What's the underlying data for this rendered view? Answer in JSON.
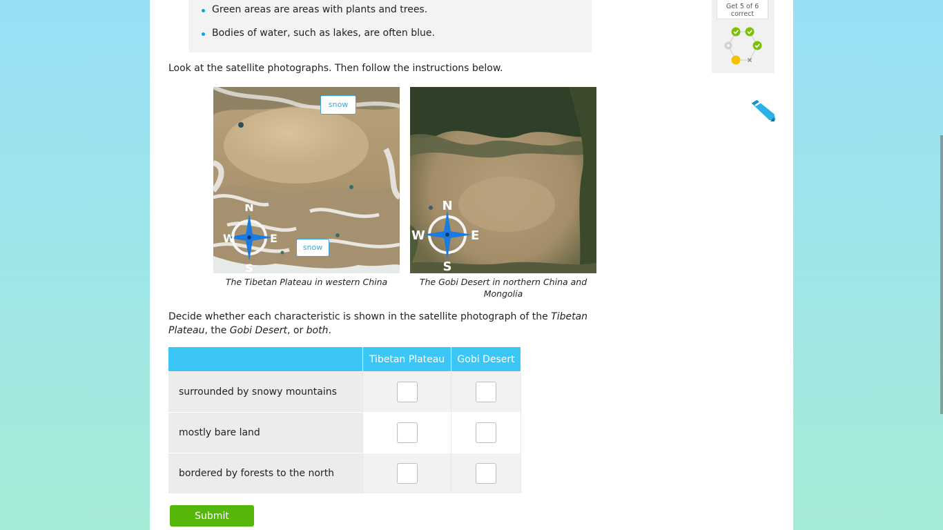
{
  "hints": [
    "Green areas are areas with plants and trees.",
    "Bodies of water, such as lakes, are often blue."
  ],
  "instructions": "Look at the satellite photographs. Then follow the instructions below.",
  "photos": [
    {
      "caption": "The Tibetan Plateau in western China",
      "labels": [
        "snow",
        "snow"
      ],
      "compass": {
        "n": "N",
        "s": "S",
        "e": "E",
        "w": "W"
      }
    },
    {
      "caption": "The Gobi Desert in northern China and Mongolia",
      "compass": {
        "n": "N",
        "s": "S",
        "e": "E",
        "w": "W"
      }
    }
  ],
  "question": {
    "part1": "Decide whether each characteristic is shown in the satellite photograph of the ",
    "em1": "Tibetan Plateau",
    "part2": ", the ",
    "em2": "Gobi Desert",
    "part3": ", or ",
    "em3": "both",
    "part4": "."
  },
  "table": {
    "columns": [
      "Tibetan Plateau",
      "Gobi Desert"
    ],
    "rows": [
      {
        "label": "surrounded by snowy mountains",
        "checked": [
          false,
          false
        ]
      },
      {
        "label": "mostly bare land",
        "checked": [
          false,
          false
        ]
      },
      {
        "label": "bordered by forests to the north",
        "checked": [
          false,
          false
        ]
      }
    ]
  },
  "submit_label": "Submit",
  "progress": {
    "goal_line1": "Get 5 of 6",
    "goal_line2": "correct",
    "status_colors": {
      "correct": "#7cc106",
      "current": "#f5c200",
      "empty": "#cfcfcf"
    }
  },
  "colors": {
    "accent": "#3bc6f5",
    "submit": "#56b70b",
    "bullet": "#0aa4e4"
  }
}
